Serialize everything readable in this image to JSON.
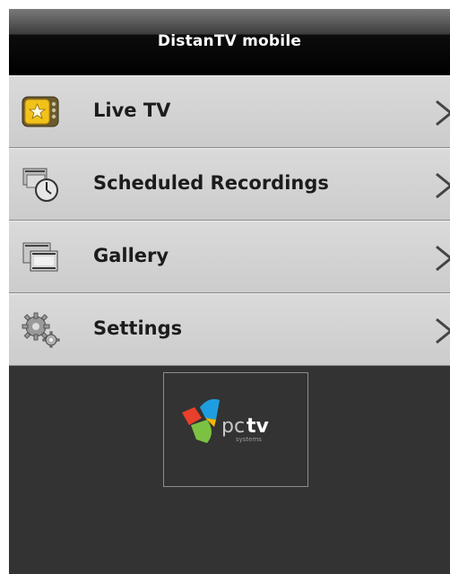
{
  "app": {
    "title": "DistanTV mobile"
  },
  "menu": {
    "items": [
      {
        "label": "Live TV",
        "icon": "tv-star-icon"
      },
      {
        "label": "Scheduled Recordings",
        "icon": "clock-recordings-icon"
      },
      {
        "label": "Gallery",
        "icon": "film-gallery-icon"
      },
      {
        "label": "Settings",
        "icon": "gears-icon"
      }
    ]
  },
  "logo": {
    "brand": "pctv",
    "tagline": "systems"
  },
  "colors": {
    "titlebar": "#000000",
    "menu_background": "#d4d4d4",
    "page_background": "#333333",
    "logo_red": "#e8402a",
    "logo_blue": "#1e9ee0",
    "logo_green": "#7cc242",
    "logo_yellow": "#f6b800"
  }
}
